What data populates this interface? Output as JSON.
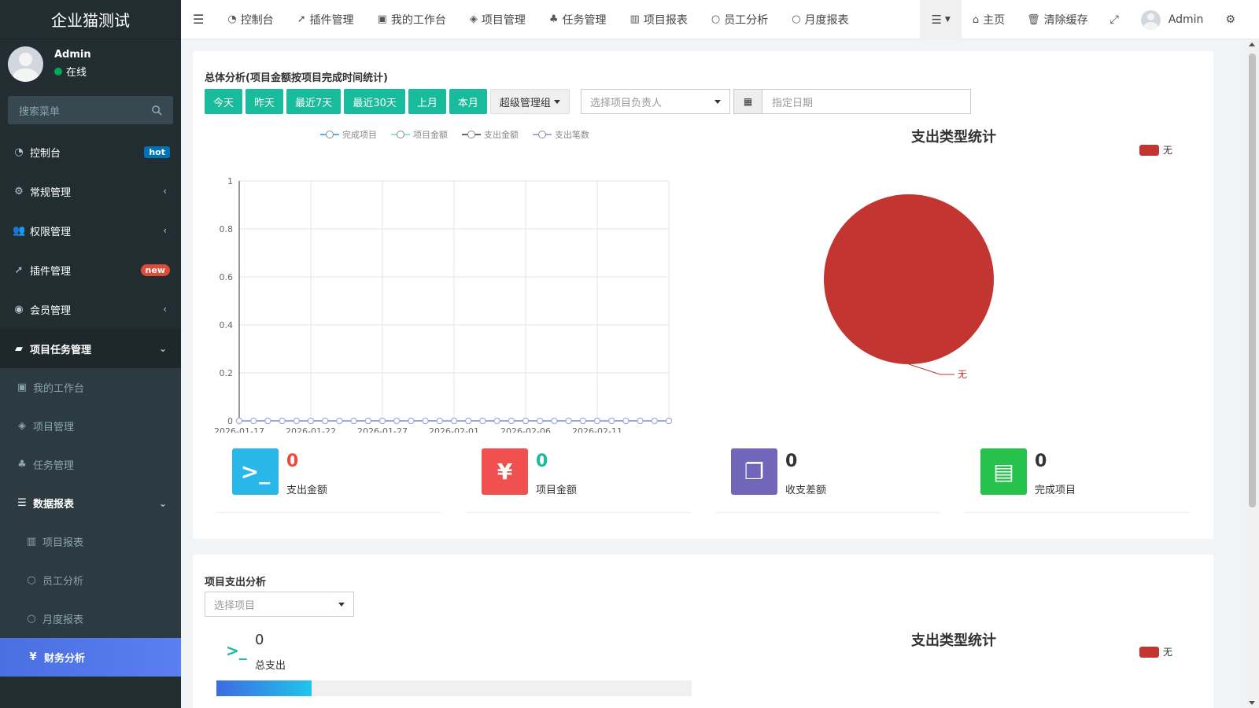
{
  "app": {
    "title": "企业猫测试"
  },
  "user": {
    "name": "Admin",
    "status": "在线"
  },
  "sidebar": {
    "search_placeholder": "搜索菜单",
    "items": [
      {
        "label": "控制台",
        "icon": "dashboard-icon",
        "badge": "hot"
      },
      {
        "label": "常规管理",
        "icon": "cogs-icon"
      },
      {
        "label": "权限管理",
        "icon": "users-icon"
      },
      {
        "label": "插件管理",
        "icon": "rocket-icon",
        "badge": "new"
      },
      {
        "label": "会员管理",
        "icon": "user-circle-icon"
      },
      {
        "label": "项目任务管理",
        "icon": "book-icon"
      }
    ],
    "sub_items": [
      {
        "label": "我的工作台",
        "icon": "calendar-check-icon"
      },
      {
        "label": "项目管理",
        "icon": "cube-icon"
      },
      {
        "label": "任务管理",
        "icon": "sitemap-icon"
      },
      {
        "label": "数据报表",
        "icon": "list-icon"
      },
      {
        "label": "项目报表",
        "icon": "bar-chart-icon"
      },
      {
        "label": "员工分析",
        "icon": "circle-icon"
      },
      {
        "label": "月度报表",
        "icon": "circle-icon"
      },
      {
        "label": "财务分析",
        "icon": "yen-icon"
      }
    ]
  },
  "topbar": {
    "tabs": [
      {
        "label": "控制台",
        "icon": "dashboard-icon"
      },
      {
        "label": "插件管理",
        "icon": "rocket-icon"
      },
      {
        "label": "我的工作台",
        "icon": "calendar-check-icon"
      },
      {
        "label": "项目管理",
        "icon": "cube-icon"
      },
      {
        "label": "任务管理",
        "icon": "sitemap-icon"
      },
      {
        "label": "项目报表",
        "icon": "bar-chart-icon"
      },
      {
        "label": "员工分析",
        "icon": "circle-icon"
      },
      {
        "label": "月度报表",
        "icon": "circle-icon"
      }
    ],
    "home": "主页",
    "clear_cache": "清除缓存",
    "user": "Admin"
  },
  "overview": {
    "title": "总体分析(项目金额按项目完成时间统计)",
    "buttons": [
      "今天",
      "昨天",
      "最近7天",
      "最近30天",
      "上月",
      "本月"
    ],
    "group_dropdown": "超级管理组",
    "owner_placeholder": "选择项目负责人",
    "date_placeholder": "指定日期",
    "stats": [
      {
        "value": "0",
        "label": "支出金额",
        "color": "#e74c3c",
        "icon": "terminal-icon",
        "bg": "#29b6e8"
      },
      {
        "value": "0",
        "label": "项目金额",
        "color": "#18bc9c",
        "icon": "yen-icon",
        "bg": "#f05050"
      },
      {
        "value": "0",
        "label": "收支差额",
        "color": "#333333",
        "icon": "copy-icon",
        "bg": "#7266ba"
      },
      {
        "value": "0",
        "label": "完成项目",
        "color": "#333333",
        "icon": "book-icon",
        "bg": "#27c24c"
      }
    ]
  },
  "expense": {
    "title": "项目支出分析",
    "select_placeholder": "选择项目",
    "total_value": "0",
    "total_label": "总支出",
    "progress": 0.2
  },
  "chart_data": [
    {
      "type": "line",
      "series": [
        {
          "name": "完成项目",
          "color": "#5ab1ef",
          "values": [
            0,
            0,
            0,
            0,
            0,
            0,
            0,
            0,
            0,
            0,
            0,
            0,
            0,
            0,
            0,
            0,
            0,
            0,
            0,
            0,
            0,
            0,
            0,
            0,
            0,
            0,
            0,
            0,
            0,
            0,
            0
          ]
        },
        {
          "name": "项目金额",
          "color": "#8ee5d5",
          "values": [
            0,
            0,
            0,
            0,
            0,
            0,
            0,
            0,
            0,
            0,
            0,
            0,
            0,
            0,
            0,
            0,
            0,
            0,
            0,
            0,
            0,
            0,
            0,
            0,
            0,
            0,
            0,
            0,
            0,
            0,
            0
          ]
        },
        {
          "name": "支出金额",
          "color": "#666666",
          "values": [
            0,
            0,
            0,
            0,
            0,
            0,
            0,
            0,
            0,
            0,
            0,
            0,
            0,
            0,
            0,
            0,
            0,
            0,
            0,
            0,
            0,
            0,
            0,
            0,
            0,
            0,
            0,
            0,
            0,
            0,
            0
          ]
        },
        {
          "name": "支出笔数",
          "color": "#a9a9e6",
          "values": [
            0,
            0,
            0,
            0,
            0,
            0,
            0,
            0,
            0,
            0,
            0,
            0,
            0,
            0,
            0,
            0,
            0,
            0,
            0,
            0,
            0,
            0,
            0,
            0,
            0,
            0,
            0,
            0,
            0,
            0,
            0
          ]
        }
      ],
      "xlabels": [
        "2026-01-17",
        "2026-01-22",
        "2026-01-27",
        "2026-02-01",
        "2026-02-06",
        "2026-02-11"
      ],
      "yticks": [
        "0",
        "0.2",
        "0.4",
        "0.6",
        "0.8",
        "1"
      ],
      "ylim": [
        0,
        1
      ]
    },
    {
      "type": "pie",
      "title": "支出类型统计",
      "slices": [
        {
          "name": "无",
          "value": 1,
          "color": "#c23531"
        }
      ]
    },
    {
      "type": "pie",
      "title": "支出类型统计",
      "slices": [
        {
          "name": "无",
          "value": 1,
          "color": "#c23531"
        }
      ]
    }
  ]
}
